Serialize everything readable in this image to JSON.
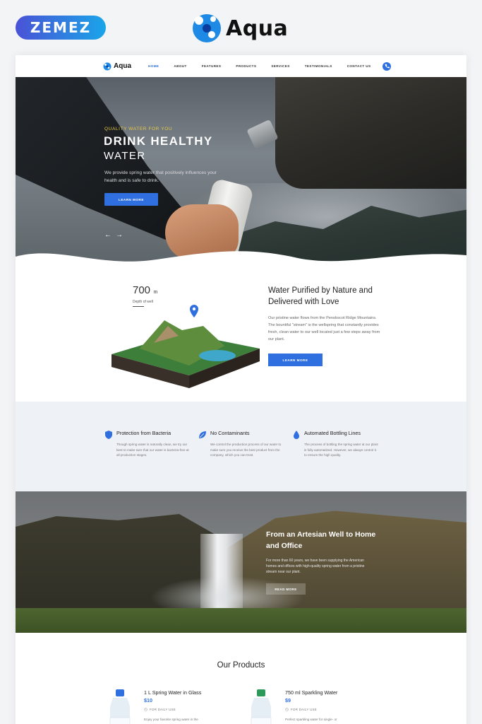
{
  "showcase": {
    "badge": "ZEMEZ",
    "brand": "Aqua"
  },
  "nav": {
    "logo": "Aqua",
    "items": [
      "HOME",
      "ABOUT",
      "FEATURES",
      "PRODUCTS",
      "SERVICES",
      "TESTIMONIALS",
      "CONTACT US"
    ],
    "active": "HOME",
    "phone_icon": "phone-icon"
  },
  "hero": {
    "kicker": "QUALITY WATER FOR YOU",
    "title_line1": "DRINK HEALTHY",
    "title_line2": "WATER",
    "description": "We provide spring water that positively influences your health and is safe to drink.",
    "button": "LEARN MORE",
    "prev": "←",
    "next": "→"
  },
  "about": {
    "depth_value": "700",
    "depth_unit": "m",
    "depth_caption": "Depth of well",
    "heading": "Water Purified by Nature and Delivered with Love",
    "body": "Our pristine water flows from the Penobscot Ridge Mountains. The bountiful \"stream\" is the wellspring that constantly provides fresh, clean water to our well located just a few steps away from our plant.",
    "button": "LEARN MORE"
  },
  "features": [
    {
      "icon": "shield-icon",
      "title": "Protection from Bacteria",
      "body": "Though spring water is naturally clean, we try our best to make sure that our water is bacteria-free at all production stages."
    },
    {
      "icon": "leaf-icon",
      "title": "No Contaminants",
      "body": "We control the production process of our water to make sure you receive the best product from the company, which you can trust."
    },
    {
      "icon": "drop-icon",
      "title": "Automated Bottling Lines",
      "body": "The process of bottling the spring water at our plant is fully automatized. However, we always control it to ensure the high quality."
    }
  ],
  "artesian": {
    "heading": "From an Artesian Well to Home and Office",
    "body": "For more than 60 years, we have been supplying the American homes and offices with high-quality spring water from a pristine stream near our plant.",
    "button": "READ MORE"
  },
  "products": {
    "title": "Our Products",
    "items": [
      {
        "name": "1 L Spring Water in Glass",
        "price": "$10",
        "tag": "FOR DAILY USE",
        "desc": "Enjoy your favorite spring water in the",
        "cap_color": "#2f6fe0"
      },
      {
        "name": "750 ml Sparkling Water",
        "price": "$9",
        "tag": "FOR DAILY USE",
        "desc": "Perfect sparkling water for single- or",
        "cap_color": "#2e9a5a"
      }
    ]
  },
  "colors": {
    "accent": "#2f6fe0",
    "kicker": "#e6c84a"
  }
}
